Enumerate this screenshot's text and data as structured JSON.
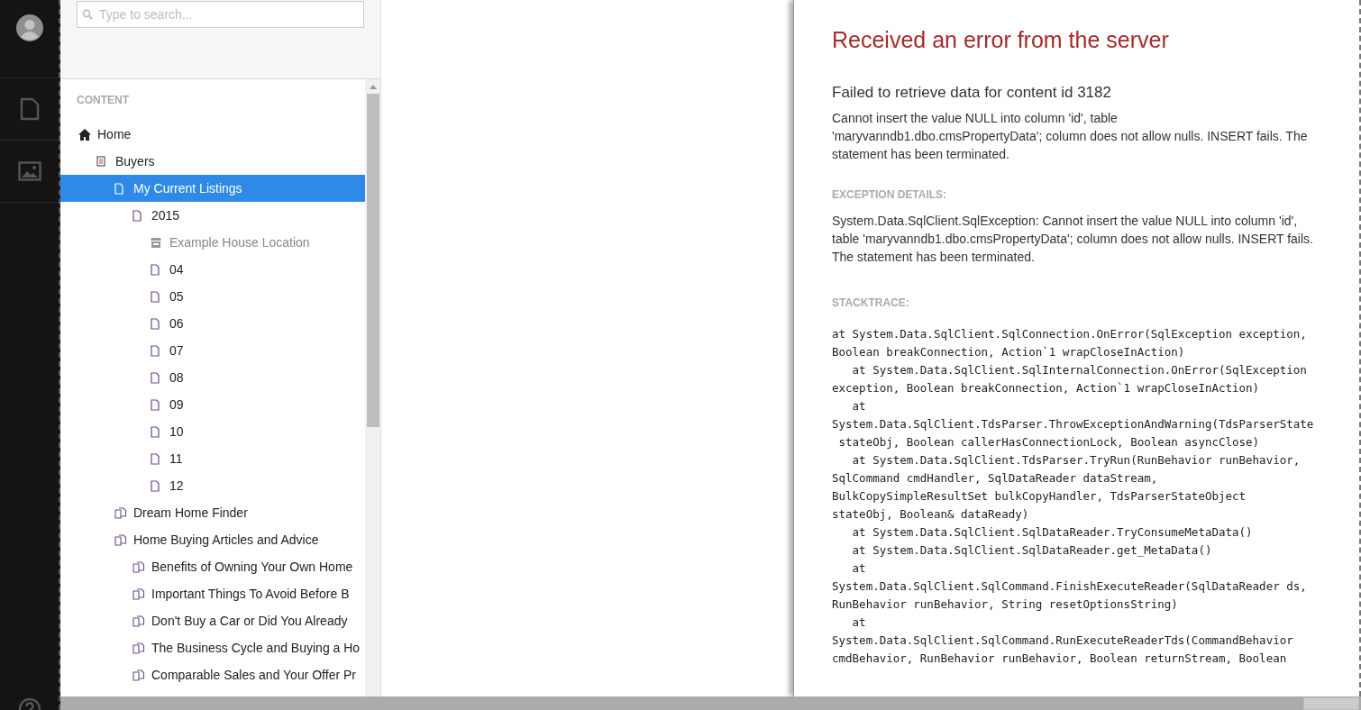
{
  "nav": {
    "items": [
      {
        "kind": "document"
      },
      {
        "kind": "media"
      }
    ]
  },
  "search": {
    "placeholder": "Type to search..."
  },
  "tree": {
    "heading": "CONTENT",
    "items": [
      {
        "label": "Home",
        "kind": "home",
        "selected": false,
        "published": true,
        "children": [
          {
            "label": "Buyers",
            "kind": "list",
            "selected": false,
            "published": true,
            "children": [
              {
                "label": "My Current Listings",
                "kind": "doc",
                "selected": true,
                "published": true,
                "children": [
                  {
                    "label": "2015",
                    "kind": "doc",
                    "selected": false,
                    "published": true,
                    "children": [
                      {
                        "label": "Example House Location",
                        "kind": "store",
                        "selected": false,
                        "published": false
                      },
                      {
                        "label": "04",
                        "kind": "doc",
                        "selected": false,
                        "published": true
                      },
                      {
                        "label": "05",
                        "kind": "doc",
                        "selected": false,
                        "published": true
                      },
                      {
                        "label": "06",
                        "kind": "doc",
                        "selected": false,
                        "published": true
                      },
                      {
                        "label": "07",
                        "kind": "doc",
                        "selected": false,
                        "published": true
                      },
                      {
                        "label": "08",
                        "kind": "doc",
                        "selected": false,
                        "published": true
                      },
                      {
                        "label": "09",
                        "kind": "doc",
                        "selected": false,
                        "published": true
                      },
                      {
                        "label": "10",
                        "kind": "doc",
                        "selected": false,
                        "published": true
                      },
                      {
                        "label": "11",
                        "kind": "doc",
                        "selected": false,
                        "published": true
                      },
                      {
                        "label": "12",
                        "kind": "doc",
                        "selected": false,
                        "published": true
                      }
                    ]
                  }
                ]
              },
              {
                "label": "Dream Home Finder",
                "kind": "docs",
                "selected": false,
                "published": true
              },
              {
                "label": "Home Buying Articles and Advice",
                "kind": "docs",
                "selected": false,
                "published": true,
                "children": [
                  {
                    "label": "Benefits of Owning Your Own Home",
                    "kind": "docs",
                    "selected": false,
                    "published": true
                  },
                  {
                    "label": "Important Things To Avoid Before B",
                    "kind": "docs",
                    "selected": false,
                    "published": true
                  },
                  {
                    "label": "Don't Buy a Car or Did You Already",
                    "kind": "docs",
                    "selected": false,
                    "published": true
                  },
                  {
                    "label": "The Business Cycle and Buying a Ho",
                    "kind": "docs",
                    "selected": false,
                    "published": true
                  },
                  {
                    "label": "Comparable Sales and Your Offer Pr",
                    "kind": "docs",
                    "selected": false,
                    "published": true
                  }
                ]
              }
            ]
          }
        ]
      }
    ]
  },
  "error": {
    "title": "Received an error from the server",
    "subtitle": "Failed to retrieve data for content id 3182",
    "message": "Cannot insert the value NULL into column 'id', table 'maryvanndb1.dbo.cmsPropertyData'; column does not allow nulls. INSERT fails. The statement has been terminated.",
    "exception_heading": "EXCEPTION DETAILS:",
    "exception": "System.Data.SqlClient.SqlException: Cannot insert the value NULL into column 'id', table 'maryvanndb1.dbo.cmsPropertyData'; column does not allow nulls. INSERT fails. The statement has been terminated.",
    "stacktrace_heading": "STACKTRACE:",
    "stacktrace": [
      "at System.Data.SqlClient.SqlConnection.OnError(SqlException exception,",
      "Boolean breakConnection, Action`1 wrapCloseInAction)",
      "   at System.Data.SqlClient.SqlInternalConnection.OnError(SqlException",
      "exception, Boolean breakConnection, Action`1 wrapCloseInAction)",
      "   at",
      "System.Data.SqlClient.TdsParser.ThrowExceptionAndWarning(TdsParserState",
      " stateObj, Boolean callerHasConnectionLock, Boolean asyncClose)",
      "   at System.Data.SqlClient.TdsParser.TryRun(RunBehavior runBehavior,",
      "SqlCommand cmdHandler, SqlDataReader dataStream,",
      "BulkCopySimpleResultSet bulkCopyHandler, TdsParserStateObject",
      "stateObj, Boolean& dataReady)",
      "   at System.Data.SqlClient.SqlDataReader.TryConsumeMetaData()",
      "   at System.Data.SqlClient.SqlDataReader.get_MetaData()",
      "   at",
      "System.Data.SqlClient.SqlCommand.FinishExecuteReader(SqlDataReader ds,",
      "RunBehavior runBehavior, String resetOptionsString)",
      "   at",
      "System.Data.SqlClient.SqlCommand.RunExecuteReaderTds(CommandBehavior",
      "cmdBehavior, RunBehavior runBehavior, Boolean returnStream, Boolean"
    ]
  }
}
